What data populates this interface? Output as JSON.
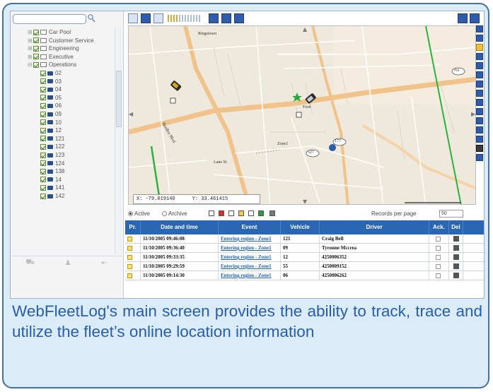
{
  "tree": {
    "groups": [
      {
        "label": "Car Pool",
        "expanded": false
      },
      {
        "label": "Customer Service",
        "expanded": false
      },
      {
        "label": "Engineering",
        "expanded": false
      },
      {
        "label": "Executive",
        "expanded": false
      },
      {
        "label": "Operations",
        "expanded": true
      }
    ],
    "vehicles": [
      "02",
      "03",
      "04",
      "05",
      "06",
      "09",
      "10",
      "12",
      "121",
      "122",
      "123",
      "124",
      "138",
      "14",
      "141",
      "142"
    ]
  },
  "map": {
    "labels": {
      "town": "Ringstown",
      "zone": "Zone1",
      "road1": "Bradley Blvd",
      "road2": "Lane St"
    },
    "vehicle_tag": "Ford",
    "coords": {
      "x_label": "X:",
      "x_value": "-79.019140",
      "y_label": "Y:",
      "y_value": "33.461415"
    },
    "highways": [
      "761",
      "177",
      "527"
    ]
  },
  "filter": {
    "active_label": "Active",
    "archive_label": "Archive",
    "records_label": "Records per page",
    "records_value": "50"
  },
  "table": {
    "headers": [
      "Pr.",
      "Date and time",
      "Event",
      "Vehicle",
      "Driver",
      "Ack.",
      "Del"
    ],
    "rows": [
      {
        "date": "11/10/2005 09:46:08",
        "event": "Entering region - Zone1",
        "vehicle": "121",
        "driver": "Craig Bell"
      },
      {
        "date": "11/10/2005 09:36:40",
        "event": "Entering region - Zone1",
        "vehicle": "09",
        "driver": "Tyronne Mccrea"
      },
      {
        "date": "11/10/2005 09:33:35",
        "event": "Entering region - Zone1",
        "vehicle": "12",
        "driver": "4250006352"
      },
      {
        "date": "11/10/2005 09:29:59",
        "event": "Entering region - Zone1",
        "vehicle": "55",
        "driver": "4250009152"
      },
      {
        "date": "11/10/2005 09:14:30",
        "event": "Entering region - Zone1",
        "vehicle": "06",
        "driver": "4250006262"
      }
    ]
  },
  "caption": "WebFleetLog's main screen provides the ability to track, trace and utilize the fleet’s online location information",
  "colors": {
    "accent": "#2b66b3",
    "caption": "#2a5caa",
    "frame_bg": "#d9ecf8"
  }
}
